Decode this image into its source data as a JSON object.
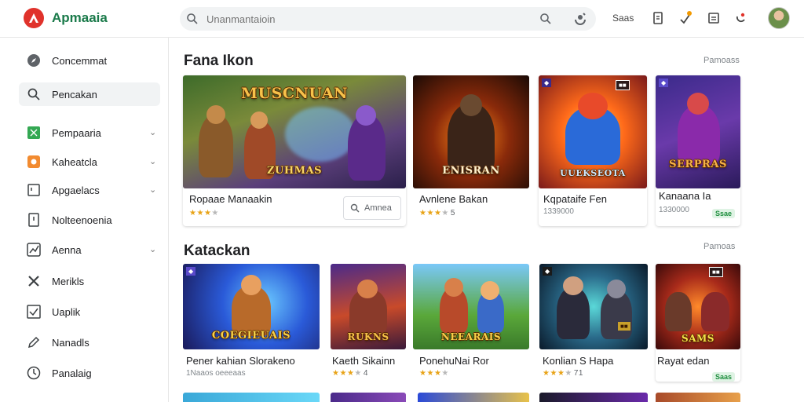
{
  "app": {
    "name": "Apmaaia"
  },
  "search": {
    "value": "",
    "placeholder": "Unanmantaioin"
  },
  "toolbar": {
    "label": "Saas"
  },
  "sidebar": {
    "items": [
      {
        "label": "Concemmat",
        "icon": "compass-icon",
        "chevron": false,
        "active": false
      },
      {
        "label": "Pencakan",
        "icon": "search-icon",
        "chevron": false,
        "active": true
      },
      {
        "label": "Pempaaria",
        "icon": "apps-icon",
        "chevron": true,
        "active": false
      },
      {
        "label": "Kaheatcla",
        "icon": "category-icon",
        "chevron": true,
        "active": false
      },
      {
        "label": "Apgaelacs",
        "icon": "frame-icon",
        "chevron": true,
        "active": false
      },
      {
        "label": "Nolteenoenia",
        "icon": "document-icon",
        "chevron": false,
        "active": false
      },
      {
        "label": "Aenna",
        "icon": "chart-icon",
        "chevron": true,
        "active": false
      },
      {
        "label": "Merikls",
        "icon": "tools-icon",
        "chevron": false,
        "active": false
      },
      {
        "label": "Uaplik",
        "icon": "check-box-icon",
        "chevron": false,
        "active": false
      },
      {
        "label": "Nanadls",
        "icon": "pencil-icon",
        "chevron": false,
        "active": false
      },
      {
        "label": "Panalaig",
        "icon": "clock-icon",
        "chevron": false,
        "active": false
      }
    ]
  },
  "sections": [
    {
      "title": "Fana Ikon",
      "more": "Pamoass",
      "cards": [
        {
          "title": "Ropaae Manaakin",
          "stars": 3,
          "rating": "",
          "art_text": "MUSCNUAN",
          "art_sub": "ZUHMAS",
          "wish_label": "Amnea",
          "price": ""
        },
        {
          "title": "Avnlene Bakan",
          "stars": 3,
          "rating": "5",
          "art_text": "ENISRAN",
          "art_sub": "",
          "wish_label": "",
          "price": ""
        },
        {
          "title": "Kqpataife Fen",
          "stars": 0,
          "rating": "",
          "meta": "1339000",
          "art_text": "UUEKSEOTA",
          "art_sub": "",
          "wish_label": "",
          "price": ""
        },
        {
          "title": "Kanaana Ia",
          "stars": 0,
          "rating": "",
          "meta": "1330000",
          "art_text": "SERPRAS",
          "art_sub": "",
          "wish_label": "",
          "price": "Ssae"
        }
      ]
    },
    {
      "title": "Katackan",
      "more": "Pamoas",
      "cards": [
        {
          "title": "Pener kahian Slorakeno",
          "meta": "1Naaos oeeeaas",
          "stars": 0,
          "rating": "",
          "art_text": "COEGIEUAIS",
          "price": ""
        },
        {
          "title": "Kaeth Sikainn",
          "stars": 3,
          "rating": "4",
          "art_text": "RUKNS",
          "price": ""
        },
        {
          "title": "PonehuNai Ror",
          "stars": 3,
          "rating": "",
          "art_text": "NEEARAIS",
          "price": ""
        },
        {
          "title": "Konlian S Hapa",
          "stars": 3,
          "rating": "71",
          "art_text": "",
          "price": ""
        },
        {
          "title": "Rayat edan",
          "stars": 0,
          "rating": "",
          "art_text": "SAMS",
          "price": "Saas"
        }
      ]
    }
  ],
  "colors": {
    "accent": "#1a7a4a",
    "logo": "#e0322b",
    "star": "#e8a317",
    "price_green": "#1e8e3e"
  }
}
